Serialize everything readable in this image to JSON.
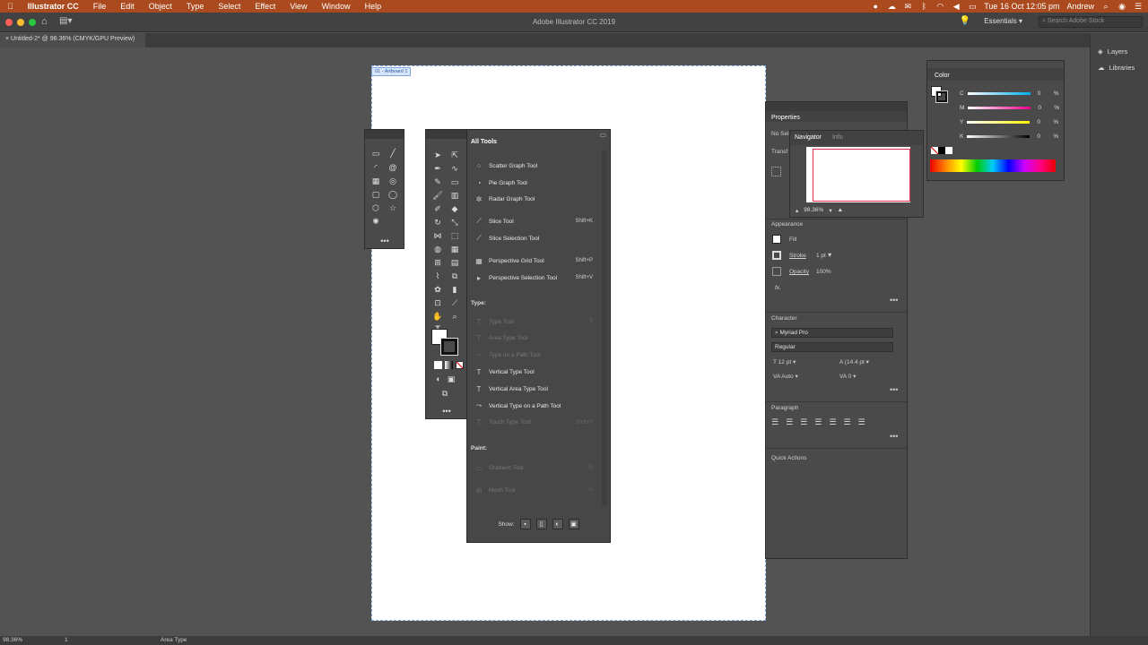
{
  "menubar": {
    "app_name": "Illustrator CC",
    "items": [
      "File",
      "Edit",
      "Object",
      "Type",
      "Select",
      "Effect",
      "View",
      "Window",
      "Help"
    ],
    "clock": "Tue 16 Oct  12:05 pm",
    "user": "Andrew"
  },
  "titlebar": {
    "title": "Adobe Illustrator CC 2019",
    "workspace": "Essentials",
    "search_placeholder": "Search Adobe Stock"
  },
  "document": {
    "tab": "Untitled-2* @ 98.36% (CMYK/GPU Preview)",
    "artboard_label": "01 - Artboard 1"
  },
  "right_strip": {
    "layers": "Layers",
    "libraries": "Libraries"
  },
  "all_tools": {
    "title": "All Tools",
    "rows_top": [
      {
        "label": "Scatter Graph Tool",
        "shortcut": "",
        "icon": "⁘",
        "disabled": false
      },
      {
        "label": "Pie Graph Tool",
        "shortcut": "",
        "icon": "◔",
        "disabled": false
      },
      {
        "label": "Radar Graph Tool",
        "shortcut": "",
        "icon": "✲",
        "disabled": false
      },
      {
        "label": "Slice Tool",
        "shortcut": "Shift+K",
        "icon": "⟋",
        "disabled": false
      },
      {
        "label": "Slice Selection Tool",
        "shortcut": "",
        "icon": "⟋",
        "disabled": false
      },
      {
        "label": "Perspective Grid Tool",
        "shortcut": "Shift+P",
        "icon": "▦",
        "disabled": false
      },
      {
        "label": "Perspective Selection Tool",
        "shortcut": "Shift+V",
        "icon": "▸",
        "disabled": false
      }
    ],
    "section_type": "Type:",
    "rows_type": [
      {
        "label": "Type Tool",
        "shortcut": "T",
        "icon": "T",
        "disabled": true
      },
      {
        "label": "Area Type Tool",
        "shortcut": "",
        "icon": "T",
        "disabled": true
      },
      {
        "label": "Type on a Path Tool",
        "shortcut": "",
        "icon": "⤳",
        "disabled": true
      },
      {
        "label": "Vertical Type Tool",
        "shortcut": "",
        "icon": "T",
        "disabled": false
      },
      {
        "label": "Vertical Area Type Tool",
        "shortcut": "",
        "icon": "T",
        "disabled": false
      },
      {
        "label": "Vertical Type on a Path Tool",
        "shortcut": "",
        "icon": "⤳",
        "disabled": false
      },
      {
        "label": "Touch Type Tool",
        "shortcut": "Shift+T",
        "icon": "T",
        "disabled": true
      }
    ],
    "section_paint": "Paint:",
    "rows_paint": [
      {
        "label": "Gradient Tool",
        "shortcut": "G",
        "icon": "▭",
        "disabled": true
      },
      {
        "label": "Mesh Tool",
        "shortcut": "U",
        "icon": "⊞",
        "disabled": true
      }
    ],
    "show_label": "Show:"
  },
  "properties": {
    "tab": "Properties",
    "no_selection": "No Sel",
    "transform": "Transf",
    "appearance": "Appearance",
    "fill": "Fill",
    "stroke": "Stroke",
    "stroke_value": "1 pt",
    "opacity": "Opacity",
    "opacity_value": "100%",
    "fx": "fx.",
    "character": "Character",
    "font_family": "Myriad Pro",
    "font_style": "Regular",
    "font_size": "12 pt",
    "leading": "(14.4 pt",
    "kerning": "Auto",
    "tracking": "0",
    "paragraph": "Paragraph",
    "quick_actions": "Quick Actions"
  },
  "navigator": {
    "tab_navigator": "Navigator",
    "tab_info": "Info",
    "zoom": "98.36%"
  },
  "color": {
    "tab": "Color",
    "channels": [
      {
        "name": "C",
        "value": "0",
        "unit": "%",
        "gradient": "linear-gradient(90deg,#fff,#00aeef)"
      },
      {
        "name": "M",
        "value": "0",
        "unit": "%",
        "gradient": "linear-gradient(90deg,#fff,#ec008c)"
      },
      {
        "name": "Y",
        "value": "0",
        "unit": "%",
        "gradient": "linear-gradient(90deg,#fff,#fff200)"
      },
      {
        "name": "K",
        "value": "0",
        "unit": "%",
        "gradient": "linear-gradient(90deg,#fff,#000)"
      }
    ]
  },
  "status": {
    "zoom": "98.36%",
    "artboard": "1",
    "tool": "Area Type"
  },
  "colors": {
    "menubar": "#ab4a1e",
    "canvas": "#535353",
    "panel": "#4a4a4a",
    "artboard_border": "#7fa9dd",
    "navigator_frame": "#e62e4a"
  }
}
